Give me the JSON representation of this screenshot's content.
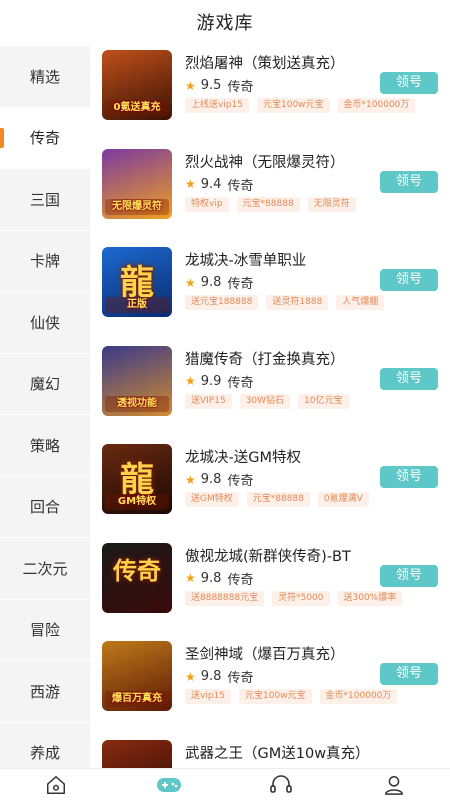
{
  "header": {
    "title": "游戏库"
  },
  "sidebar": {
    "items": [
      {
        "label": "精选",
        "active": false
      },
      {
        "label": "传奇",
        "active": true
      },
      {
        "label": "三国",
        "active": false
      },
      {
        "label": "卡牌",
        "active": false
      },
      {
        "label": "仙侠",
        "active": false
      },
      {
        "label": "魔幻",
        "active": false
      },
      {
        "label": "策略",
        "active": false
      },
      {
        "label": "回合",
        "active": false
      },
      {
        "label": "二次元",
        "active": false
      },
      {
        "label": "冒险",
        "active": false
      },
      {
        "label": "西游",
        "active": false
      },
      {
        "label": "养成",
        "active": false
      }
    ]
  },
  "games": [
    {
      "name": "烈焰屠神（策划送真充）",
      "score": "9.5",
      "genre": "传奇",
      "claim": "领号",
      "tags": [
        "上线送vip15",
        "元宝100w元宝",
        "金币*100000万"
      ],
      "thumb_tag": "0氪送真充",
      "thumb_glyph": "",
      "colors": [
        "#c0501a",
        "#3a1206"
      ]
    },
    {
      "name": "烈火战神（无限爆灵符）",
      "score": "9.4",
      "genre": "传奇",
      "claim": "领号",
      "tags": [
        "特权vip",
        "元宝*88888",
        "无限灵符"
      ],
      "thumb_tag": "无限爆灵符",
      "thumb_glyph": "",
      "colors": [
        "#7a3aa0",
        "#f0a020"
      ]
    },
    {
      "name": "龙城决-冰雪单职业",
      "score": "9.8",
      "genre": "传奇",
      "claim": "领号",
      "tags": [
        "送元宝188888",
        "送灵符1888",
        "人气爆棚"
      ],
      "thumb_tag": "正版",
      "thumb_glyph": "龍",
      "colors": [
        "#1c6ad0",
        "#0a2a70"
      ]
    },
    {
      "name": "猎魔传奇（打金换真充）",
      "score": "9.9",
      "genre": "传奇",
      "claim": "领号",
      "tags": [
        "送VIP15",
        "30W钻石",
        "10亿元宝"
      ],
      "thumb_tag": "透视功能",
      "thumb_glyph": "",
      "colors": [
        "#3a3a8a",
        "#d08a30"
      ]
    },
    {
      "name": "龙城决-送GM特权",
      "score": "9.8",
      "genre": "传奇",
      "claim": "领号",
      "tags": [
        "送GM特权",
        "元宝*88888",
        "0氪爆满V"
      ],
      "thumb_tag": "GM特权",
      "thumb_glyph": "龍",
      "colors": [
        "#6a2a10",
        "#1a0804"
      ]
    },
    {
      "name": "傲视龙城(新群侠传奇)-BT",
      "score": "9.8",
      "genre": "传奇",
      "claim": "领号",
      "tags": [
        "送8888888元宝",
        "灵符*5000",
        "送300%爆率"
      ],
      "thumb_tag": "",
      "thumb_glyph": "传奇",
      "colors": [
        "#1a1a1a",
        "#3a0a0a"
      ]
    },
    {
      "name": "圣剑神域（爆百万真充）",
      "score": "9.8",
      "genre": "传奇",
      "claim": "领号",
      "tags": [
        "送vip15",
        "元宝100w元宝",
        "金币*100000万"
      ],
      "thumb_tag": "爆百万真充",
      "thumb_glyph": "",
      "colors": [
        "#c07a1a",
        "#5a1a06"
      ]
    },
    {
      "name": "武器之王（GM送10w真充）",
      "score": "",
      "genre": "",
      "claim": "",
      "tags": [],
      "thumb_tag": "",
      "thumb_glyph": "",
      "colors": [
        "#8a2a10",
        "#2a0a04"
      ]
    }
  ],
  "tabbar": {
    "items": [
      {
        "icon": "home-icon",
        "active": false
      },
      {
        "icon": "gamepad-icon",
        "active": true
      },
      {
        "icon": "headset-icon",
        "active": false
      },
      {
        "icon": "profile-icon",
        "active": false
      }
    ]
  },
  "colors": {
    "accent": "#5ec7c8",
    "active_indicator": "#f08a24",
    "star": "#f3a01c",
    "tag_text": "#e48a5a",
    "tag_bg": "#fdf0e8"
  }
}
